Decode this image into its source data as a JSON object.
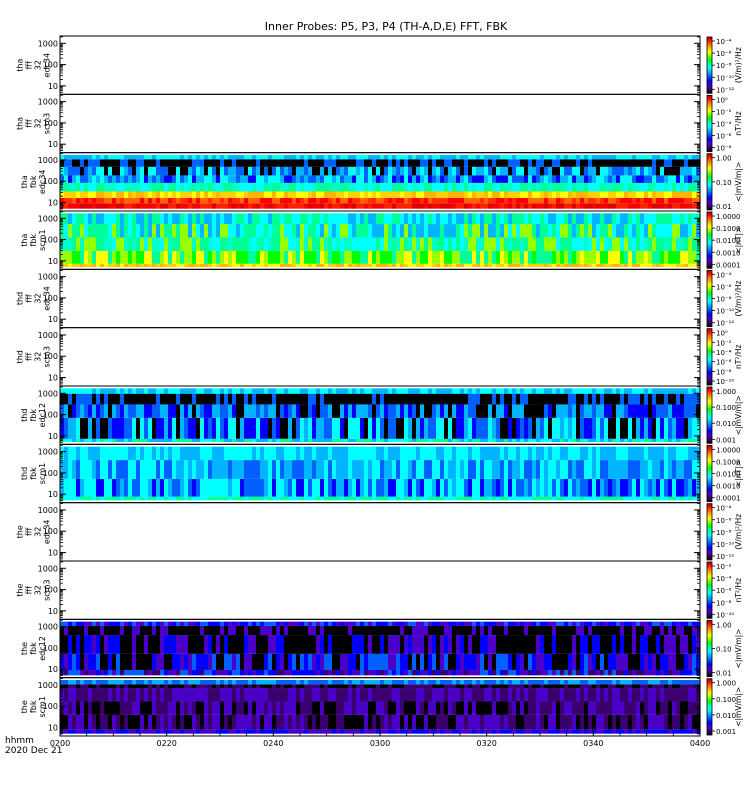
{
  "chart_data": {
    "type": "heatmap",
    "title": "Inner Probes: P5, P3, P4 (TH-A,D,E) FFT, FBK",
    "x_axis": {
      "tick_labels": [
        "0200",
        "0220",
        "0240",
        "0300",
        "0320",
        "0340",
        "0400"
      ],
      "label_line1": "hhmm",
      "label_line2": "2020 Dec 21"
    },
    "y_tick_labels": [
      "1000",
      "100",
      "10"
    ],
    "panels": [
      {
        "name": "tha-fff-32-edc34",
        "ylabel": [
          "tha",
          "fff",
          "32",
          "edc34"
        ],
        "kind": "empty",
        "colorbar": {
          "ticks": [
            "10⁻⁴",
            "10⁻⁶",
            "10⁻⁸",
            "10⁻¹⁰",
            "10⁻¹²"
          ],
          "label": "(V/m)²/Hz"
        }
      },
      {
        "name": "tha-fff-32-scm3",
        "ylabel": [
          "tha",
          "fff",
          "32",
          "scm3"
        ],
        "kind": "empty",
        "colorbar": {
          "ticks": [
            "10⁰",
            "10⁻²",
            "10⁻⁴",
            "10⁻⁶",
            "10⁻⁸"
          ],
          "label": "nT²/Hz"
        }
      },
      {
        "name": "tha-fbk-edc34",
        "ylabel": [
          "tha",
          "fbk",
          "edc34"
        ],
        "kind": "edc-high",
        "colorbar": {
          "ticks": [
            "1.00",
            "0.10",
            "0.01"
          ],
          "label": "<|mV/m|>"
        }
      },
      {
        "name": "tha-fbk-scm1",
        "ylabel": [
          "tha",
          "fbk",
          "scm1"
        ],
        "kind": "scm-mid",
        "colorbar": {
          "ticks": [
            "1.0000",
            "0.1000",
            "0.0100",
            "0.0010",
            "0.0001"
          ],
          "label": "<|nT|>"
        }
      },
      {
        "name": "thd-fff-32-edc34",
        "ylabel": [
          "thd",
          "fff",
          "32",
          "edc34"
        ],
        "kind": "empty",
        "colorbar": {
          "ticks": [
            "10⁻⁴",
            "10⁻⁶",
            "10⁻⁸",
            "10⁻¹⁰",
            "10⁻¹²"
          ],
          "label": "(V/m)²/Hz"
        }
      },
      {
        "name": "thd-fff-32-scm3",
        "ylabel": [
          "thd",
          "fff",
          "32",
          "scm3"
        ],
        "kind": "empty",
        "colorbar": {
          "ticks": [
            "10⁰",
            "10⁻²",
            "10⁻⁴",
            "10⁻⁶",
            "10⁻⁸",
            "10⁻¹⁰"
          ],
          "label": "nT²/Hz"
        }
      },
      {
        "name": "thd-fbk-edc12",
        "ylabel": [
          "thd",
          "fbk",
          "edc12"
        ],
        "kind": "edc-low",
        "colorbar": {
          "ticks": [
            "1.000",
            "0.100",
            "0.010",
            "0.001"
          ],
          "label": "<|mV/m|>"
        }
      },
      {
        "name": "thd-fbk-scm1",
        "ylabel": [
          "thd",
          "fbk",
          "scm1"
        ],
        "kind": "scm-low",
        "colorbar": {
          "ticks": [
            "1.0000",
            "0.1000",
            "0.0100",
            "0.0010",
            "0.0001"
          ],
          "label": "<|nT|>"
        }
      },
      {
        "name": "the-fff-32-edc34",
        "ylabel": [
          "the",
          "fff",
          "32",
          "edc34"
        ],
        "kind": "empty",
        "colorbar": {
          "ticks": [
            "10⁻⁴",
            "10⁻⁶",
            "10⁻⁸",
            "10⁻¹⁰",
            "10⁻¹²"
          ],
          "label": "(V/m)²/Hz"
        }
      },
      {
        "name": "the-fff-32-scm3",
        "ylabel": [
          "the",
          "fff",
          "32",
          "scm3"
        ],
        "kind": "empty",
        "colorbar": {
          "ticks": [
            "10⁻²",
            "10⁻⁴",
            "10⁻⁶",
            "10⁻⁸",
            "10⁻¹⁰"
          ],
          "label": "nT²/Hz"
        }
      },
      {
        "name": "the-fbk-edc12",
        "ylabel": [
          "the",
          "fbk",
          "edc12"
        ],
        "kind": "edc-vlow",
        "colorbar": {
          "ticks": [
            "1.00",
            "0.10",
            "0.01"
          ],
          "label": "<|mV/m|>"
        }
      },
      {
        "name": "the-fbk-scm1",
        "ylabel": [
          "the",
          "fbk",
          "scm1"
        ],
        "kind": "scm-vlow",
        "colorbar": {
          "ticks": [
            "1.000",
            "0.100",
            "0.010",
            "0.001"
          ],
          "label": "<|mV/m|>"
        }
      }
    ]
  },
  "colorbar_colors": [
    "#000000",
    "#3a006e",
    "#4b00c8",
    "#0000ff",
    "#0060ff",
    "#00b4ff",
    "#00ffff",
    "#00ff96",
    "#00ff00",
    "#96ff00",
    "#ffff00",
    "#ffb400",
    "#ff6400",
    "#ff0000",
    "#b40000"
  ]
}
